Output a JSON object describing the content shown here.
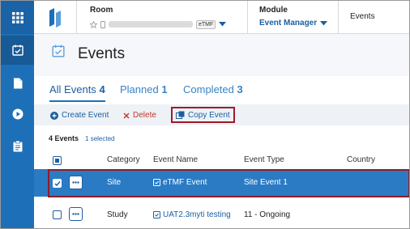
{
  "rail": {
    "items": [
      {
        "icon": "grid-icon"
      },
      {
        "icon": "calendar-check-icon",
        "active": true
      },
      {
        "icon": "document-icon"
      },
      {
        "icon": "play-icon"
      },
      {
        "icon": "clipboard-icon"
      }
    ]
  },
  "header": {
    "room_label": "Room",
    "room_tag": "eTMF",
    "module_label": "Module",
    "module_value": "Event Manager",
    "breadcrumb_current": "Events"
  },
  "page": {
    "title": "Events"
  },
  "tabs": [
    {
      "label": "All Events",
      "count": "4",
      "active": true
    },
    {
      "label": "Planned",
      "count": "1"
    },
    {
      "label": "Completed",
      "count": "3"
    }
  ],
  "toolbar": {
    "create_label": "Create Event",
    "delete_label": "Delete",
    "copy_label": "Copy Event"
  },
  "summary": {
    "total": "4 Events",
    "selected": "1 selected"
  },
  "table": {
    "columns": [
      "Category",
      "Event Name",
      "Event Type",
      "Country"
    ],
    "rows": [
      {
        "category": "Site",
        "event_name": "eTMF Event",
        "event_type": "Site Event 1",
        "country": "",
        "selected": true
      },
      {
        "category": "Study",
        "event_name": "UAT2.3myti testing",
        "event_type": "11 - Ongoing",
        "country": "",
        "selected": false
      }
    ]
  },
  "colors": {
    "rail": "#1d6fb8",
    "accent": "#1d5fa0",
    "selected_row": "#2a7bc4",
    "highlight_outline": "#a1192a",
    "delete": "#c0392b"
  }
}
